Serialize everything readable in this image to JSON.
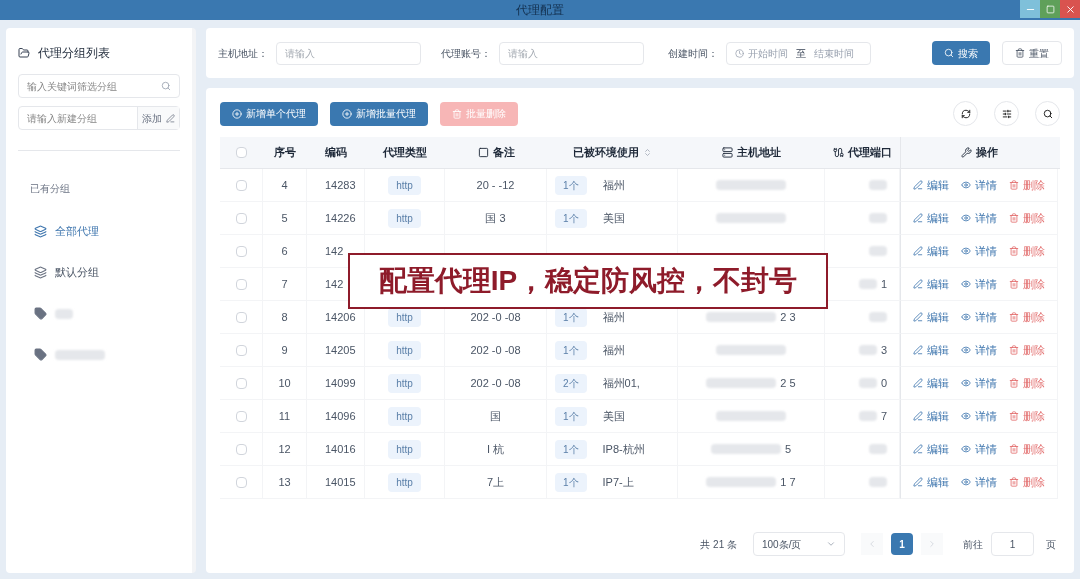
{
  "window": {
    "title": "代理配置"
  },
  "sidebar": {
    "title": "代理分组列表",
    "filter_placeholder": "输入关键词筛选分组",
    "new_group_placeholder": "请输入新建分组",
    "add_button": "添加",
    "section_label": "已有分组",
    "groups": [
      {
        "kind": "layers",
        "label": "全部代理",
        "selected": true
      },
      {
        "kind": "layers",
        "label": "默认分组",
        "selected": false
      },
      {
        "kind": "tag",
        "selected": false
      },
      {
        "kind": "tag",
        "selected": false
      }
    ]
  },
  "filters": {
    "host_label": "主机地址：",
    "host_placeholder": "请输入",
    "account_label": "代理账号：",
    "account_placeholder": "请输入",
    "time_label": "创建时间：",
    "start_placeholder": "开始时间",
    "range_sep": "至",
    "end_placeholder": "结束时间",
    "search_button": "搜索",
    "reset_button": "重置"
  },
  "toolbar": {
    "add_single": "新增单个代理",
    "add_batch": "新增批量代理",
    "batch_delete": "批量删除",
    "batch_delete_disabled": true
  },
  "table": {
    "select_all_checked": false,
    "columns": [
      "序号",
      "编码",
      "代理类型",
      "备注",
      "已被环境使用",
      "主机地址",
      "代理端口",
      "操作"
    ],
    "rows": [
      {
        "checked": false,
        "index": "4",
        "code": "14283",
        "type": "http",
        "remark": "20 - -12",
        "count": "1个",
        "env": "福州",
        "host": "",
        "port": "",
        "actions": [
          "编辑",
          "详情",
          "删除"
        ]
      },
      {
        "checked": false,
        "index": "5",
        "code": "14226",
        "type": "http",
        "remark": "国 3",
        "count": "1个",
        "env": "美国",
        "host": "",
        "port": "",
        "actions": [
          "编辑",
          "详情",
          "删除"
        ]
      },
      {
        "checked": false,
        "index": "6",
        "code": "142",
        "port": "",
        "actions": [
          "编辑",
          "详情",
          "删除"
        ]
      },
      {
        "checked": false,
        "index": "7",
        "code": "142",
        "port": "1",
        "actions": [
          "编辑",
          "详情",
          "删除"
        ]
      },
      {
        "checked": false,
        "index": "8",
        "code": "14206",
        "type": "http",
        "remark": "202 -0 -08",
        "count": "1个",
        "env": "福州",
        "host": "2 3",
        "port": "",
        "actions": [
          "编辑",
          "详情",
          "删除"
        ]
      },
      {
        "checked": false,
        "index": "9",
        "code": "14205",
        "type": "http",
        "remark": "202 -0 -08",
        "count": "1个",
        "env": "福州",
        "host": "",
        "port": "3",
        "actions": [
          "编辑",
          "详情",
          "删除"
        ]
      },
      {
        "checked": false,
        "index": "10",
        "code": "14099",
        "type": "http",
        "remark": "202 -0 -08",
        "count": "2个",
        "env": "福州01,",
        "host": "2 5",
        "port": "0",
        "actions": [
          "编辑",
          "详情",
          "删除"
        ]
      },
      {
        "checked": false,
        "index": "11",
        "code": "14096",
        "type": "http",
        "remark": "国",
        "count": "1个",
        "env": "美国",
        "host": "",
        "port": "7",
        "actions": [
          "编辑",
          "详情",
          "删除"
        ]
      },
      {
        "checked": false,
        "index": "12",
        "code": "14016",
        "type": "http",
        "remark": "I 杭",
        "count": "1个",
        "env": "IP8-杭州",
        "host": "5",
        "port": "",
        "actions": [
          "编辑",
          "详情",
          "删除"
        ]
      },
      {
        "checked": false,
        "index": "13",
        "code": "14015",
        "type": "http",
        "remark": "7上",
        "count": "1个",
        "env": "IP7-上",
        "host": "1 7",
        "port": "",
        "actions": [
          "编辑",
          "详情",
          "删除"
        ]
      }
    ]
  },
  "pagination": {
    "total": "共 21 条",
    "page_size": "100条/页",
    "pages": [
      {
        "label": "1",
        "selected": true
      }
    ],
    "goto_label": "前往",
    "goto_value": "1",
    "page_unit": "页"
  },
  "banner": "配置代理IP，稳定防风控，不封号"
}
